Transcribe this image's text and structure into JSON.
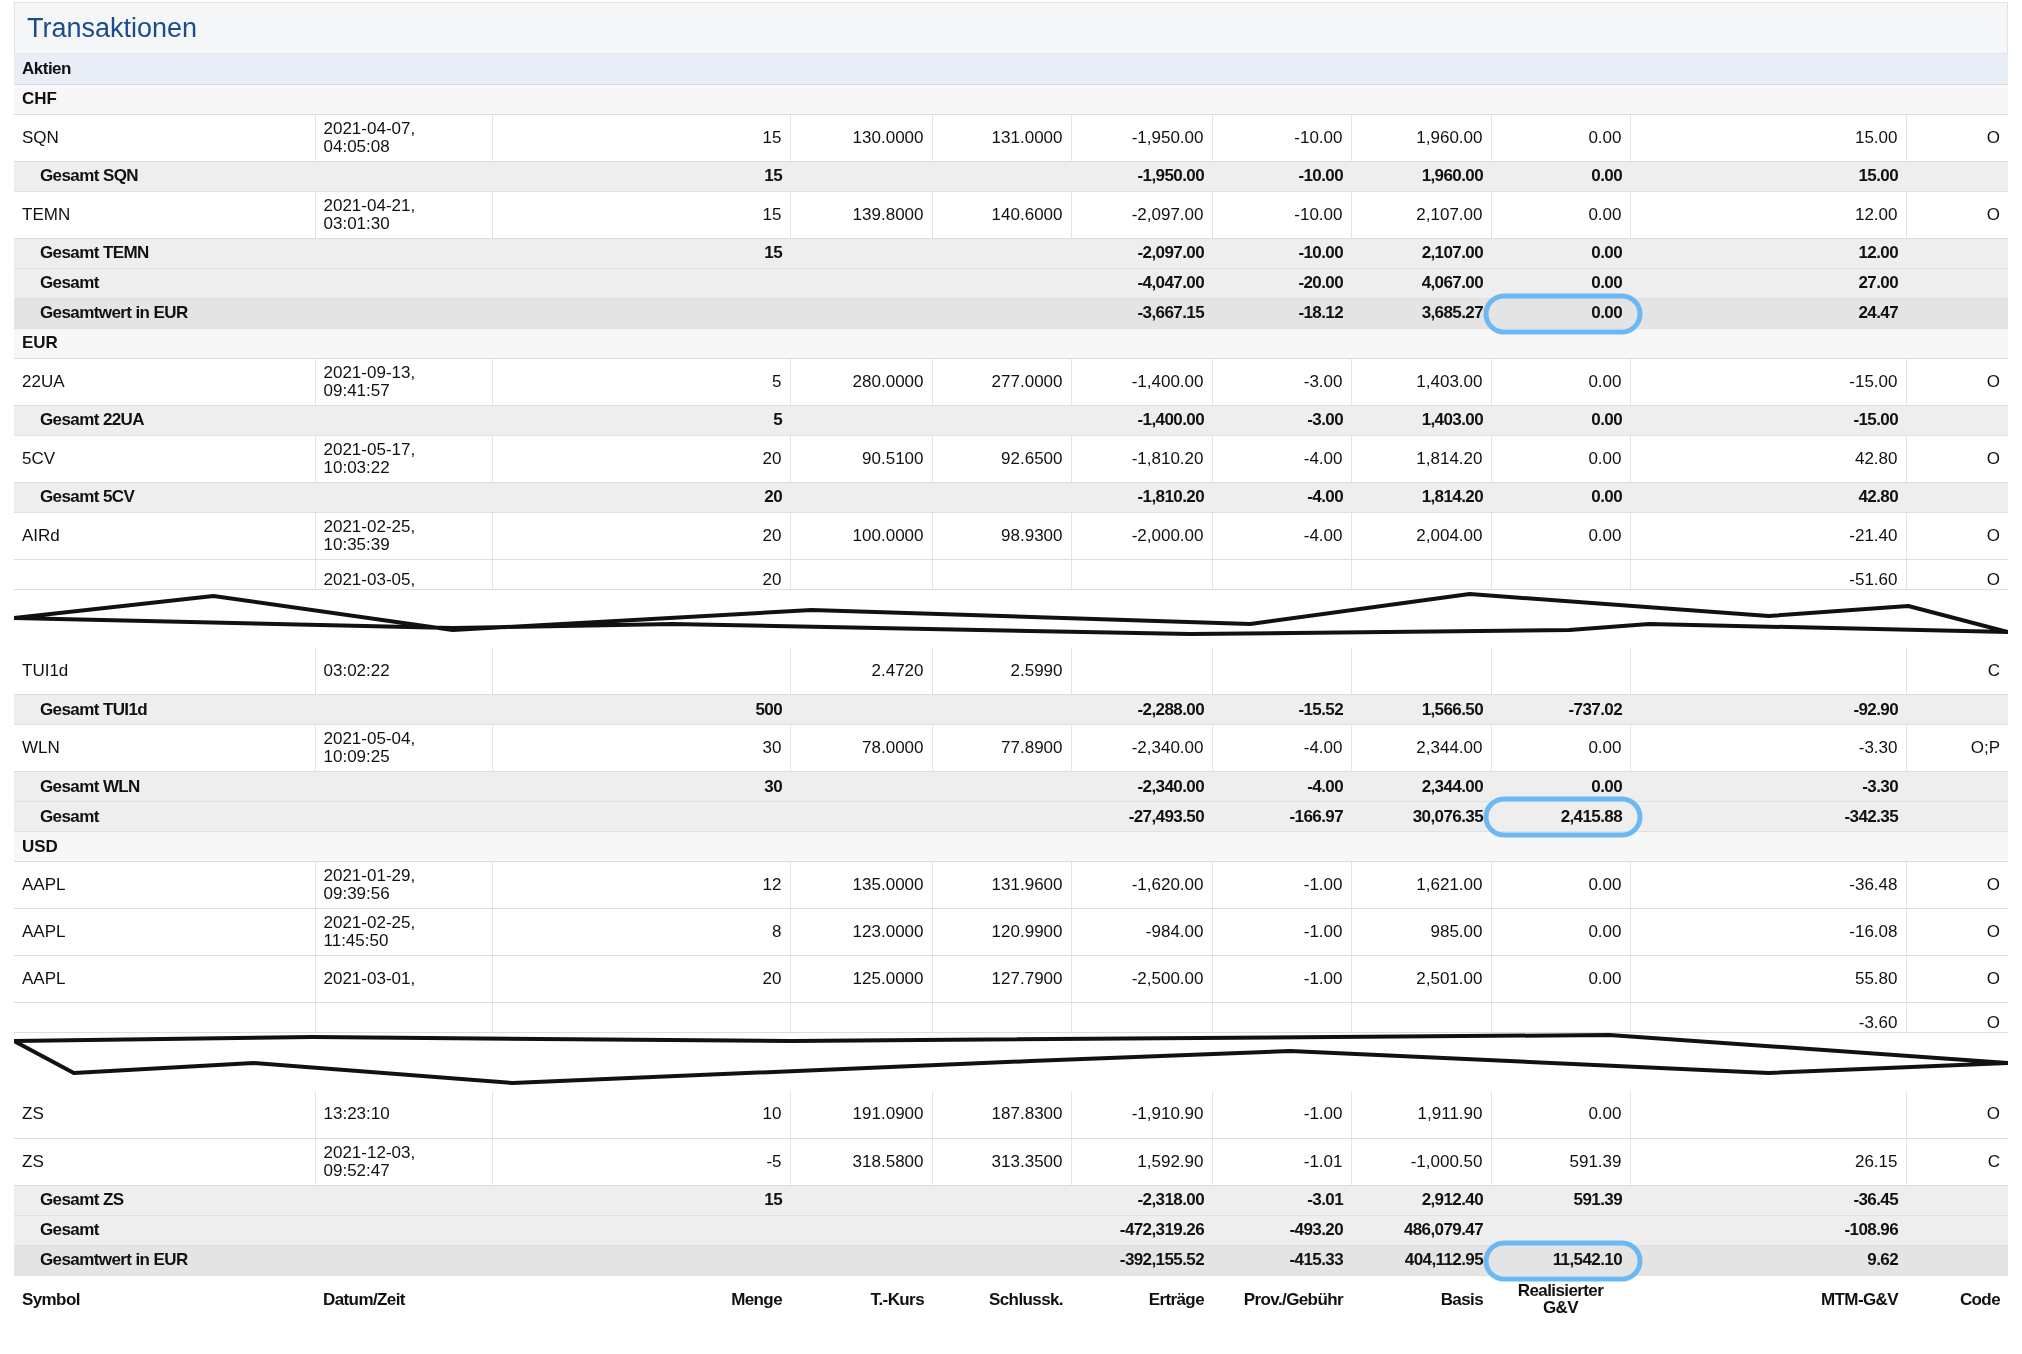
{
  "title": "Transaktionen",
  "section": "Aktien",
  "groups": [
    {
      "currency": "CHF",
      "rows": [
        {
          "kind": "trade",
          "symbol": "SQN",
          "date": "2021-04-07, 04:05:08",
          "quantity": "15",
          "t_price": "130.0000",
          "close_price": "131.0000",
          "proceeds": "-1,950.00",
          "fee": "-10.00",
          "basis": "1,960.00",
          "realized_pl": "0.00",
          "mtm_pl": "15.00",
          "code": "O"
        },
        {
          "kind": "subtotal",
          "label": "Gesamt SQN",
          "quantity": "15",
          "proceeds": "-1,950.00",
          "fee": "-10.00",
          "basis": "1,960.00",
          "realized_pl": "0.00",
          "mtm_pl": "15.00",
          "circled": false
        },
        {
          "kind": "trade",
          "symbol": "TEMN",
          "date": "2021-04-21, 03:01:30",
          "quantity": "15",
          "t_price": "139.8000",
          "close_price": "140.6000",
          "proceeds": "-2,097.00",
          "fee": "-10.00",
          "basis": "2,107.00",
          "realized_pl": "0.00",
          "mtm_pl": "12.00",
          "code": "O"
        },
        {
          "kind": "subtotal",
          "label": "Gesamt TEMN",
          "quantity": "15",
          "proceeds": "-2,097.00",
          "fee": "-10.00",
          "basis": "2,107.00",
          "realized_pl": "0.00",
          "mtm_pl": "12.00",
          "circled": false
        },
        {
          "kind": "subtotal",
          "label": "Gesamt",
          "proceeds": "-4,047.00",
          "fee": "-20.00",
          "basis": "4,067.00",
          "realized_pl": "0.00",
          "mtm_pl": "27.00",
          "circled": false
        },
        {
          "kind": "total_eur",
          "label": "Gesamtwert in EUR",
          "proceeds": "-3,667.15",
          "fee": "-18.12",
          "basis": "3,685.27",
          "realized_pl": "0.00",
          "mtm_pl": "24.47",
          "circled": true
        }
      ]
    },
    {
      "currency": "EUR",
      "rows": [
        {
          "kind": "trade",
          "symbol": "22UA",
          "date": "2021-09-13, 09:41:57",
          "quantity": "5",
          "t_price": "280.0000",
          "close_price": "277.0000",
          "proceeds": "-1,400.00",
          "fee": "-3.00",
          "basis": "1,403.00",
          "realized_pl": "0.00",
          "mtm_pl": "-15.00",
          "code": "O"
        },
        {
          "kind": "subtotal",
          "label": "Gesamt 22UA",
          "quantity": "5",
          "proceeds": "-1,400.00",
          "fee": "-3.00",
          "basis": "1,403.00",
          "realized_pl": "0.00",
          "mtm_pl": "-15.00",
          "circled": false
        },
        {
          "kind": "trade",
          "symbol": "5CV",
          "date": "2021-05-17, 10:03:22",
          "quantity": "20",
          "t_price": "90.5100",
          "close_price": "92.6500",
          "proceeds": "-1,810.20",
          "fee": "-4.00",
          "basis": "1,814.20",
          "realized_pl": "0.00",
          "mtm_pl": "42.80",
          "code": "O"
        },
        {
          "kind": "subtotal",
          "label": "Gesamt 5CV",
          "quantity": "20",
          "proceeds": "-1,810.20",
          "fee": "-4.00",
          "basis": "1,814.20",
          "realized_pl": "0.00",
          "mtm_pl": "42.80",
          "circled": false
        },
        {
          "kind": "trade",
          "symbol": "AIRd",
          "date": "2021-02-25, 10:35:39",
          "quantity": "20",
          "t_price": "100.0000",
          "close_price": "98.9300",
          "proceeds": "-2,000.00",
          "fee": "-4.00",
          "basis": "2,004.00",
          "realized_pl": "0.00",
          "mtm_pl": "-21.40",
          "code": "O"
        },
        {
          "kind": "cut_trade",
          "date": "2021-03-05,",
          "quantity": "20",
          "mtm_pl": "-51.60",
          "code": "O"
        },
        {
          "kind": "torn_gap"
        },
        {
          "kind": "trade",
          "symbol": "TUI1d",
          "date": "03:02:22",
          "t_price": "2.4720",
          "close_price": "2.5990",
          "code": "C"
        },
        {
          "kind": "subtotal",
          "label": "Gesamt TUI1d",
          "quantity": "500",
          "proceeds": "-2,288.00",
          "fee": "-15.52",
          "basis": "1,566.50",
          "realized_pl": "-737.02",
          "mtm_pl": "-92.90",
          "circled": false
        },
        {
          "kind": "trade",
          "symbol": "WLN",
          "date": "2021-05-04, 10:09:25",
          "quantity": "30",
          "t_price": "78.0000",
          "close_price": "77.8900",
          "proceeds": "-2,340.00",
          "fee": "-4.00",
          "basis": "2,344.00",
          "realized_pl": "0.00",
          "mtm_pl": "-3.30",
          "code": "O;P"
        },
        {
          "kind": "subtotal",
          "label": "Gesamt WLN",
          "quantity": "30",
          "proceeds": "-2,340.00",
          "fee": "-4.00",
          "basis": "2,344.00",
          "realized_pl": "0.00",
          "mtm_pl": "-3.30",
          "circled": false
        },
        {
          "kind": "subtotal",
          "label": "Gesamt",
          "proceeds": "-27,493.50",
          "fee": "-166.97",
          "basis": "30,076.35",
          "realized_pl": "2,415.88",
          "mtm_pl": "-342.35",
          "circled": true
        }
      ]
    },
    {
      "currency": "USD",
      "rows": [
        {
          "kind": "trade",
          "symbol": "AAPL",
          "date": "2021-01-29, 09:39:56",
          "quantity": "12",
          "t_price": "135.0000",
          "close_price": "131.9600",
          "proceeds": "-1,620.00",
          "fee": "-1.00",
          "basis": "1,621.00",
          "realized_pl": "0.00",
          "mtm_pl": "-36.48",
          "code": "O"
        },
        {
          "kind": "trade",
          "symbol": "AAPL",
          "date": "2021-02-25, 11:45:50",
          "quantity": "8",
          "t_price": "123.0000",
          "close_price": "120.9900",
          "proceeds": "-984.00",
          "fee": "-1.00",
          "basis": "985.00",
          "realized_pl": "0.00",
          "mtm_pl": "-16.08",
          "code": "O"
        },
        {
          "kind": "trade",
          "symbol": "AAPL",
          "date": "2021-03-01,",
          "quantity": "20",
          "t_price": "125.0000",
          "close_price": "127.7900",
          "proceeds": "-2,500.00",
          "fee": "-1.00",
          "basis": "2,501.00",
          "realized_pl": "0.00",
          "mtm_pl": "55.80",
          "code": "O"
        },
        {
          "kind": "cut_trade",
          "mtm_pl": "-3.60",
          "code": "O"
        },
        {
          "kind": "torn_gap"
        },
        {
          "kind": "trade",
          "symbol": "ZS",
          "date": "13:23:10",
          "quantity": "10",
          "t_price": "191.0900",
          "close_price": "187.8300",
          "proceeds": "-1,910.90",
          "fee": "-1.00",
          "basis": "1,911.90",
          "realized_pl": "0.00",
          "code": "O"
        },
        {
          "kind": "trade",
          "symbol": "ZS",
          "date": "2021-12-03, 09:52:47",
          "quantity": "-5",
          "t_price": "318.5800",
          "close_price": "313.3500",
          "proceeds": "1,592.90",
          "fee": "-1.01",
          "basis": "-1,000.50",
          "realized_pl": "591.39",
          "mtm_pl": "26.15",
          "code": "C"
        },
        {
          "kind": "subtotal",
          "label": "Gesamt ZS",
          "quantity": "15",
          "proceeds": "-2,318.00",
          "fee": "-3.01",
          "basis": "2,912.40",
          "realized_pl": "591.39",
          "mtm_pl": "-36.45",
          "circled": false
        },
        {
          "kind": "subtotal",
          "label": "Gesamt",
          "proceeds": "-472,319.26",
          "fee": "-493.20",
          "basis": "486,079.47",
          "mtm_pl": "-108.96",
          "circled": false
        },
        {
          "kind": "total_eur",
          "label": "Gesamtwert in EUR",
          "proceeds": "-392,155.52",
          "fee": "-415.33",
          "basis": "404,112.95",
          "realized_pl": "11,542.10",
          "mtm_pl": "9.62",
          "circled": true
        }
      ]
    }
  ],
  "columns": [
    "Symbol",
    "Datum/Zeit",
    "Menge",
    "T.-Kurs",
    "Schlussk.",
    "Erträge",
    "Prov./Gebühr",
    "Basis",
    "Realisierter G&V",
    "MTM-G&V",
    "Code"
  ]
}
